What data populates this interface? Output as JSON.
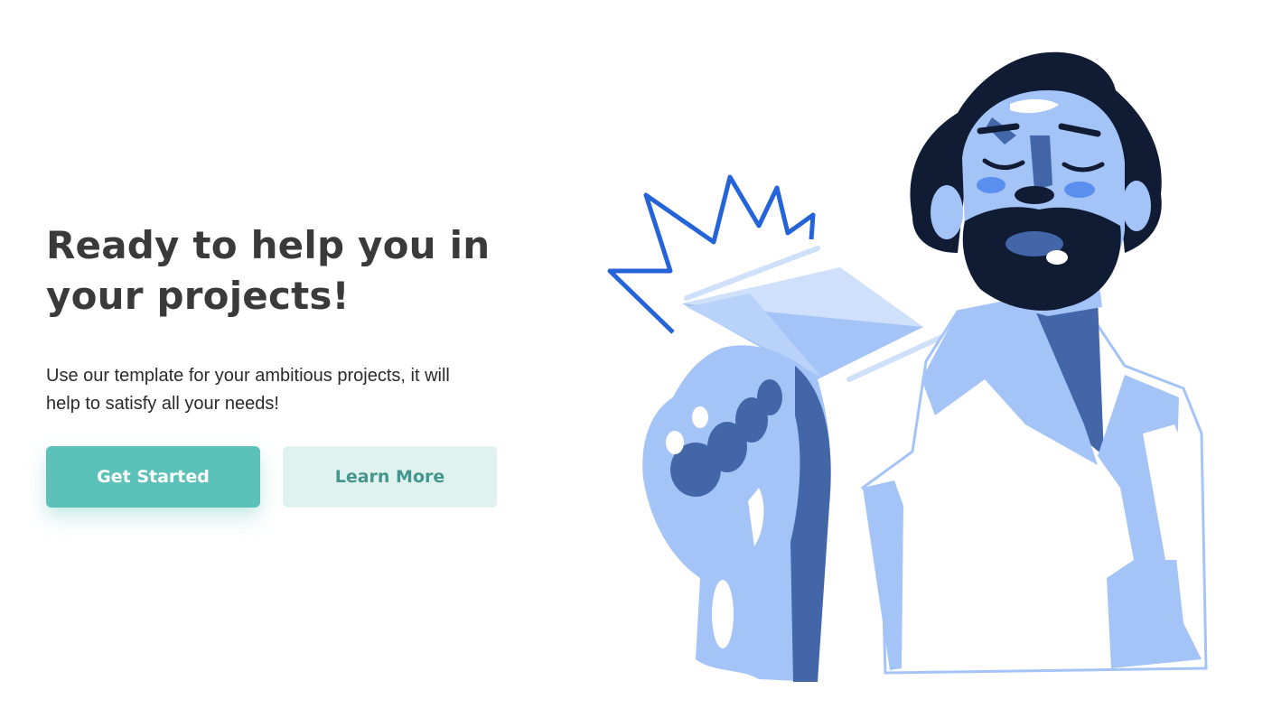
{
  "hero": {
    "title_line1": "Ready to help you in",
    "title_line2": "your projects!",
    "subtitle_line1": "Use our template for your ambitious projects, it will",
    "subtitle_line2": "help to satisfy all your needs!"
  },
  "actions": {
    "primary_label": "Get Started",
    "secondary_label": "Learn More"
  },
  "colors": {
    "title": "#3a3a3a",
    "primary": "#5cc1b8",
    "secondary_bg": "#dff2f0",
    "secondary_text": "#45958f",
    "illustration_dark": "#101b34",
    "illustration_mid": "#4366a8",
    "illustration_light": "#a4c3f7",
    "illustration_accent": "#2563d9"
  },
  "illustration": {
    "icon": "man-throwing-paper-plane-illustration"
  }
}
